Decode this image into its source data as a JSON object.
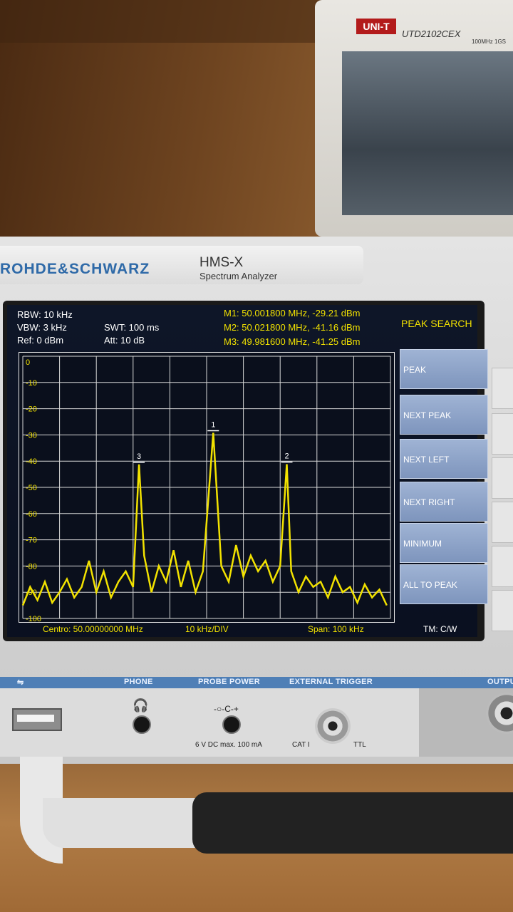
{
  "scope": {
    "brand": "UNI-T",
    "model": "UTD2102CEX",
    "spec": "100MHz 1GS"
  },
  "device": {
    "brand": "ROHDE&SCHWARZ",
    "model": "HMS-X",
    "subtitle": "Spectrum Analyzer"
  },
  "settings": {
    "rbw": "RBW: 10 kHz",
    "vbw": "VBW: 3 kHz",
    "ref": "Ref: 0 dBm",
    "swt": "SWT: 100 ms",
    "att": "Att: 10 dB"
  },
  "markers": {
    "m1": "M1: 50.001800 MHz, -29.21 dBm",
    "m2": "M2: 50.021800 MHz, -41.16 dBm",
    "m3": "M3: 49.981600 MHz, -41.25 dBm"
  },
  "menu": {
    "title": "PEAK SEARCH",
    "items": [
      "PEAK",
      "NEXT PEAK",
      "NEXT LEFT",
      "NEXT RIGHT",
      "MINIMUM",
      "ALL TO PEAK"
    ]
  },
  "footer": {
    "center": "Centro: 50.00000000 MHz",
    "div": "10 kHz/DIV",
    "span": "Span: 100 kHz",
    "trace_mode": "TM: C/W"
  },
  "panel": {
    "phone": "PHONE",
    "probe_power": "PROBE POWER",
    "external_trigger": "EXTERNAL TRIGGER",
    "output": "OUTPUT",
    "probe_rating": "6 V DC  max. 100 mA",
    "cat": "CAT I",
    "ttl": "TTL",
    "probe_symbol": "-○-C-+"
  },
  "colors": {
    "trace": "#f2e200",
    "softkey": "#8ea3c9",
    "brand_blue": "#2f6aa8"
  },
  "chart_data": {
    "type": "line",
    "x_unit": "MHz",
    "y_unit": "dBm",
    "xlim": [
      49.95,
      50.05
    ],
    "ylim": [
      -100,
      0
    ],
    "ytick_labels": [
      "0",
      "-10",
      "-20",
      "-30",
      "-40",
      "-50",
      "-60",
      "-70",
      "-80",
      "-90",
      "-100"
    ],
    "grid": true,
    "markers": [
      {
        "label": "1",
        "x": 50.0018,
        "y": -29.21
      },
      {
        "label": "2",
        "x": 50.0218,
        "y": -41.16
      },
      {
        "label": "3",
        "x": 49.9816,
        "y": -41.25
      }
    ],
    "series": [
      {
        "x": [
          49.95,
          49.952,
          49.954,
          49.956,
          49.958,
          49.96,
          49.962,
          49.964,
          49.966,
          49.968,
          49.97,
          49.972,
          49.974,
          49.976,
          49.978,
          49.98,
          49.9816,
          49.983,
          49.985,
          49.987,
          49.989,
          49.991,
          49.993,
          49.995,
          49.997,
          49.999,
          50.0018,
          50.004,
          50.006,
          50.008,
          50.01,
          50.012,
          50.014,
          50.016,
          50.018,
          50.02,
          50.0218,
          50.023,
          50.025,
          50.027,
          50.029,
          50.031,
          50.033,
          50.035,
          50.037,
          50.039,
          50.041,
          50.043,
          50.045,
          50.047,
          50.049
        ],
        "y": [
          -95,
          -88,
          -93,
          -86,
          -94,
          -90,
          -85,
          -92,
          -88,
          -78,
          -90,
          -82,
          -92,
          -86,
          -82,
          -88,
          -41.25,
          -76,
          -90,
          -80,
          -86,
          -74,
          -88,
          -78,
          -90,
          -82,
          -29.21,
          -80,
          -86,
          -72,
          -84,
          -76,
          -82,
          -78,
          -86,
          -80,
          -41.16,
          -82,
          -90,
          -84,
          -88,
          -86,
          -92,
          -84,
          -90,
          -88,
          -94,
          -87,
          -92,
          -89,
          -95
        ]
      }
    ]
  }
}
